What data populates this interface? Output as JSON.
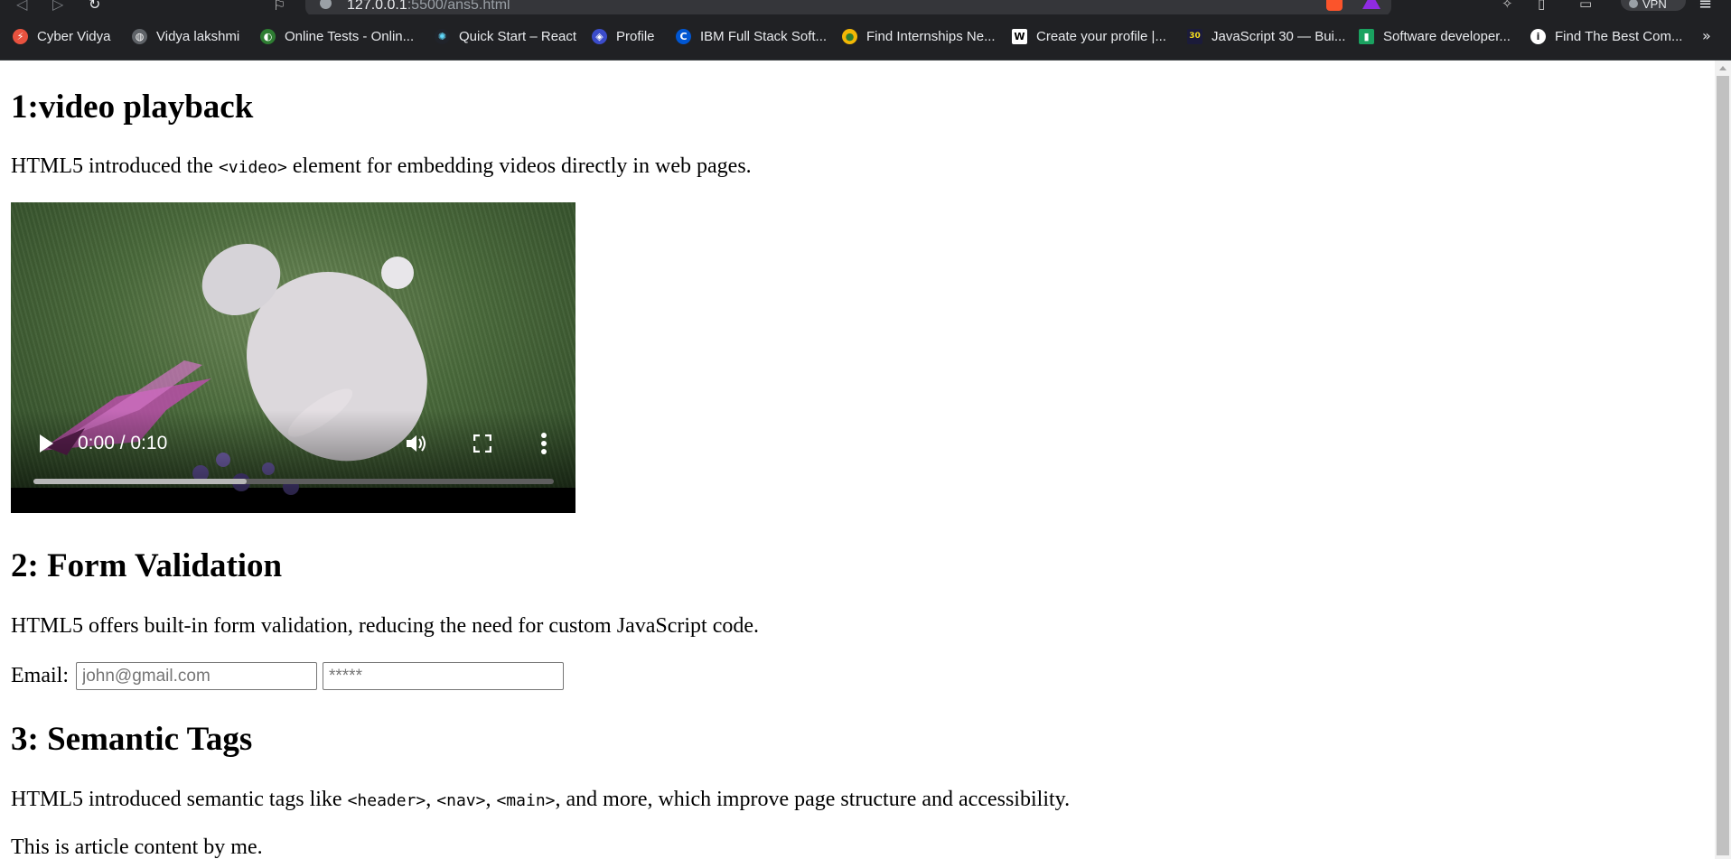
{
  "browser": {
    "url_host": "127.0.0.1",
    "url_rest": ":5500/ans5.html",
    "vpn_label": "VPN"
  },
  "bookmarks": [
    {
      "label": "Cyber Vidya",
      "icon": "cyber-vidya-icon",
      "color": "#e8523f",
      "glyph": "⚡"
    },
    {
      "label": "Vidya lakshmi",
      "icon": "globe-icon",
      "color": "#5f6368",
      "glyph": "◍"
    },
    {
      "label": "Online Tests - Onlin...",
      "icon": "online-tests-icon",
      "color": "#2e7d32",
      "glyph": "◐"
    },
    {
      "label": "Quick Start – React",
      "icon": "react-icon",
      "color": "#20232a",
      "glyph": "✺"
    },
    {
      "label": "Profile",
      "icon": "profile-icon",
      "color": "#3b4cca",
      "glyph": "◈"
    },
    {
      "label": "IBM Full Stack Soft...",
      "icon": "coursera-icon",
      "color": "#0056d2",
      "glyph": "C"
    },
    {
      "label": "Find Internships Ne...",
      "icon": "internships-icon",
      "color": "#f2b705",
      "glyph": "●"
    },
    {
      "label": "Create your profile |...",
      "icon": "w-icon",
      "color": "#ffffff",
      "glyph": "W"
    },
    {
      "label": "JavaScript 30 — Bui...",
      "icon": "js30-icon",
      "color": "#1b1b3a",
      "glyph": "30"
    },
    {
      "label": "Software developer...",
      "icon": "naukri-icon",
      "color": "#1aa260",
      "glyph": "▮"
    },
    {
      "label": "Find The Best Com...",
      "icon": "info-icon",
      "color": "#ffffff",
      "glyph": "i"
    }
  ],
  "page": {
    "section1": {
      "title": "1:video playback",
      "text_before": "HTML5 introduced the ",
      "code": "<video>",
      "text_after": " element for embedding videos directly in web pages.",
      "video": {
        "time": "0:00 / 0:10",
        "progress": 0.41
      }
    },
    "section2": {
      "title": "2: Form Validation",
      "text": "HTML5 offers built-in form validation, reducing the need for custom JavaScript code.",
      "email_label": "Email:",
      "email_placeholder": "john@gmail.com",
      "password_placeholder": "*****"
    },
    "section3": {
      "title": "3: Semantic Tags",
      "text_a": "HTML5 introduced semantic tags like ",
      "code_header": "<header>",
      "sep1": ", ",
      "code_nav": "<nav>",
      "sep2": ", ",
      "code_main": "<main>",
      "text_b": ", and more, which improve page structure and accessibility.",
      "article": "This is article content by me."
    }
  }
}
